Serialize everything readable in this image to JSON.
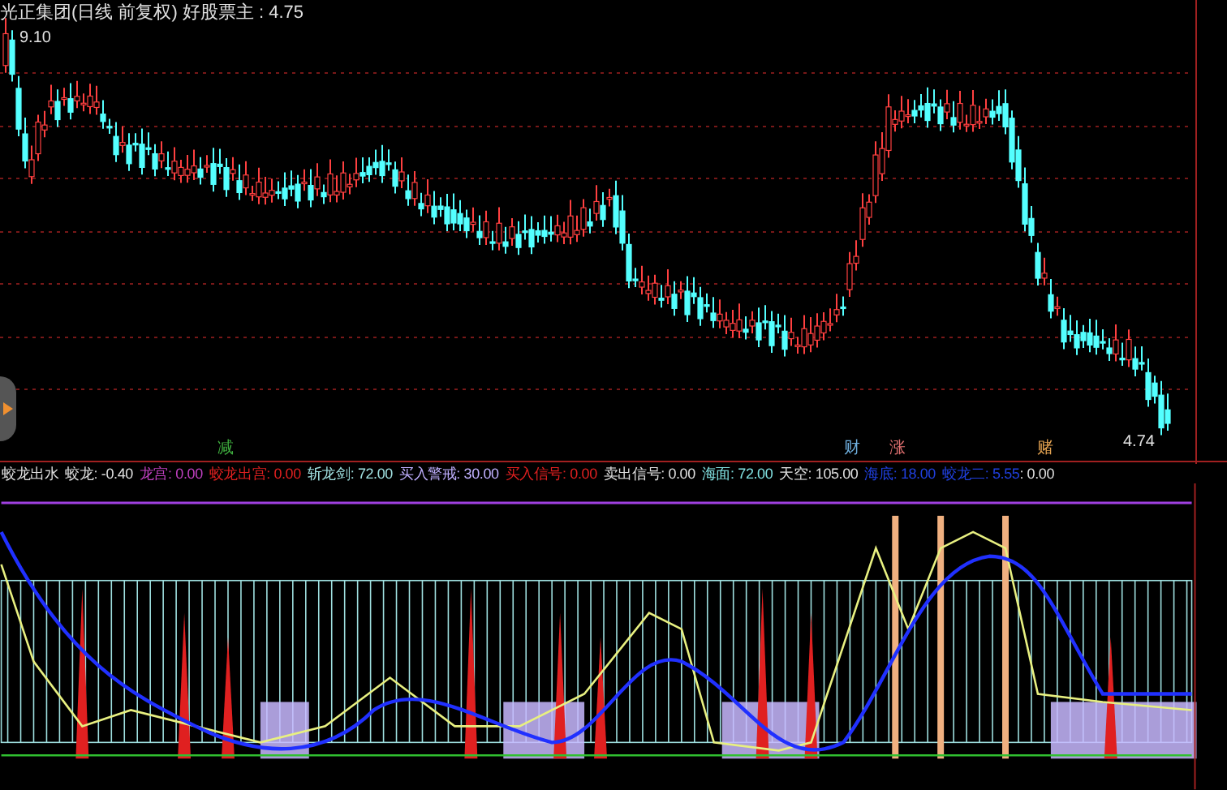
{
  "main_chart": {
    "title": "光正集团(日线 前复权) 好股票主 : 4.75",
    "high_label": "9.10",
    "low_label": "4.74",
    "markers": [
      {
        "text": "减",
        "color": "#3fae3f"
      },
      {
        "text": "财",
        "color": "#6fb0e0"
      },
      {
        "text": "涨",
        "color": "#e07070"
      },
      {
        "text": "赌",
        "color": "#e0a050"
      }
    ]
  },
  "indicator": {
    "name": "蛟龙出水",
    "legend": [
      {
        "label": "蛟龙:",
        "value": "-0.40",
        "color": "#e0e0e0"
      },
      {
        "label": "龙宫:",
        "value": "0.00",
        "color": "#c040c0"
      },
      {
        "label": "蛟龙出宫:",
        "value": "0.00",
        "color": "#e02020"
      },
      {
        "label": "斩龙剑:",
        "value": "72.00",
        "color": "#a0e0e0"
      },
      {
        "label": "买入警戒:",
        "value": "30.00",
        "color": "#c0b0ff"
      },
      {
        "label": "买入信号:",
        "value": "0.00",
        "color": "#e02020"
      },
      {
        "label": "卖出信号:",
        "value": "0.00",
        "color": "#e0e0e0"
      },
      {
        "label": "海面:",
        "value": "72.00",
        "color": "#80e0e0"
      },
      {
        "label": "天空:",
        "value": "105.00",
        "color": "#e0e0e0"
      },
      {
        "label": "海底:",
        "value": "18.00",
        "color": "#2040e0"
      },
      {
        "label": "蛟龙二:",
        "value": "5.55",
        "color": "#2040e0"
      }
    ],
    "tail": ": 0.00"
  }
}
